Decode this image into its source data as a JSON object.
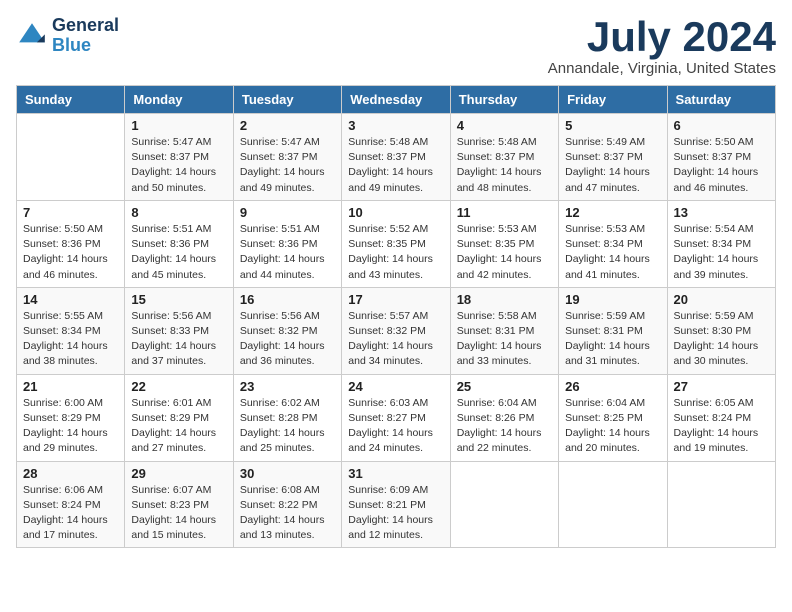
{
  "logo": {
    "line1": "General",
    "line2": "Blue"
  },
  "title": "July 2024",
  "location": "Annandale, Virginia, United States",
  "columns": [
    "Sunday",
    "Monday",
    "Tuesday",
    "Wednesday",
    "Thursday",
    "Friday",
    "Saturday"
  ],
  "weeks": [
    [
      {
        "day": "",
        "content": ""
      },
      {
        "day": "1",
        "content": "Sunrise: 5:47 AM\nSunset: 8:37 PM\nDaylight: 14 hours\nand 50 minutes."
      },
      {
        "day": "2",
        "content": "Sunrise: 5:47 AM\nSunset: 8:37 PM\nDaylight: 14 hours\nand 49 minutes."
      },
      {
        "day": "3",
        "content": "Sunrise: 5:48 AM\nSunset: 8:37 PM\nDaylight: 14 hours\nand 49 minutes."
      },
      {
        "day": "4",
        "content": "Sunrise: 5:48 AM\nSunset: 8:37 PM\nDaylight: 14 hours\nand 48 minutes."
      },
      {
        "day": "5",
        "content": "Sunrise: 5:49 AM\nSunset: 8:37 PM\nDaylight: 14 hours\nand 47 minutes."
      },
      {
        "day": "6",
        "content": "Sunrise: 5:50 AM\nSunset: 8:37 PM\nDaylight: 14 hours\nand 46 minutes."
      }
    ],
    [
      {
        "day": "7",
        "content": "Sunrise: 5:50 AM\nSunset: 8:36 PM\nDaylight: 14 hours\nand 46 minutes."
      },
      {
        "day": "8",
        "content": "Sunrise: 5:51 AM\nSunset: 8:36 PM\nDaylight: 14 hours\nand 45 minutes."
      },
      {
        "day": "9",
        "content": "Sunrise: 5:51 AM\nSunset: 8:36 PM\nDaylight: 14 hours\nand 44 minutes."
      },
      {
        "day": "10",
        "content": "Sunrise: 5:52 AM\nSunset: 8:35 PM\nDaylight: 14 hours\nand 43 minutes."
      },
      {
        "day": "11",
        "content": "Sunrise: 5:53 AM\nSunset: 8:35 PM\nDaylight: 14 hours\nand 42 minutes."
      },
      {
        "day": "12",
        "content": "Sunrise: 5:53 AM\nSunset: 8:34 PM\nDaylight: 14 hours\nand 41 minutes."
      },
      {
        "day": "13",
        "content": "Sunrise: 5:54 AM\nSunset: 8:34 PM\nDaylight: 14 hours\nand 39 minutes."
      }
    ],
    [
      {
        "day": "14",
        "content": "Sunrise: 5:55 AM\nSunset: 8:34 PM\nDaylight: 14 hours\nand 38 minutes."
      },
      {
        "day": "15",
        "content": "Sunrise: 5:56 AM\nSunset: 8:33 PM\nDaylight: 14 hours\nand 37 minutes."
      },
      {
        "day": "16",
        "content": "Sunrise: 5:56 AM\nSunset: 8:32 PM\nDaylight: 14 hours\nand 36 minutes."
      },
      {
        "day": "17",
        "content": "Sunrise: 5:57 AM\nSunset: 8:32 PM\nDaylight: 14 hours\nand 34 minutes."
      },
      {
        "day": "18",
        "content": "Sunrise: 5:58 AM\nSunset: 8:31 PM\nDaylight: 14 hours\nand 33 minutes."
      },
      {
        "day": "19",
        "content": "Sunrise: 5:59 AM\nSunset: 8:31 PM\nDaylight: 14 hours\nand 31 minutes."
      },
      {
        "day": "20",
        "content": "Sunrise: 5:59 AM\nSunset: 8:30 PM\nDaylight: 14 hours\nand 30 minutes."
      }
    ],
    [
      {
        "day": "21",
        "content": "Sunrise: 6:00 AM\nSunset: 8:29 PM\nDaylight: 14 hours\nand 29 minutes."
      },
      {
        "day": "22",
        "content": "Sunrise: 6:01 AM\nSunset: 8:29 PM\nDaylight: 14 hours\nand 27 minutes."
      },
      {
        "day": "23",
        "content": "Sunrise: 6:02 AM\nSunset: 8:28 PM\nDaylight: 14 hours\nand 25 minutes."
      },
      {
        "day": "24",
        "content": "Sunrise: 6:03 AM\nSunset: 8:27 PM\nDaylight: 14 hours\nand 24 minutes."
      },
      {
        "day": "25",
        "content": "Sunrise: 6:04 AM\nSunset: 8:26 PM\nDaylight: 14 hours\nand 22 minutes."
      },
      {
        "day": "26",
        "content": "Sunrise: 6:04 AM\nSunset: 8:25 PM\nDaylight: 14 hours\nand 20 minutes."
      },
      {
        "day": "27",
        "content": "Sunrise: 6:05 AM\nSunset: 8:24 PM\nDaylight: 14 hours\nand 19 minutes."
      }
    ],
    [
      {
        "day": "28",
        "content": "Sunrise: 6:06 AM\nSunset: 8:24 PM\nDaylight: 14 hours\nand 17 minutes."
      },
      {
        "day": "29",
        "content": "Sunrise: 6:07 AM\nSunset: 8:23 PM\nDaylight: 14 hours\nand 15 minutes."
      },
      {
        "day": "30",
        "content": "Sunrise: 6:08 AM\nSunset: 8:22 PM\nDaylight: 14 hours\nand 13 minutes."
      },
      {
        "day": "31",
        "content": "Sunrise: 6:09 AM\nSunset: 8:21 PM\nDaylight: 14 hours\nand 12 minutes."
      },
      {
        "day": "",
        "content": ""
      },
      {
        "day": "",
        "content": ""
      },
      {
        "day": "",
        "content": ""
      }
    ]
  ]
}
